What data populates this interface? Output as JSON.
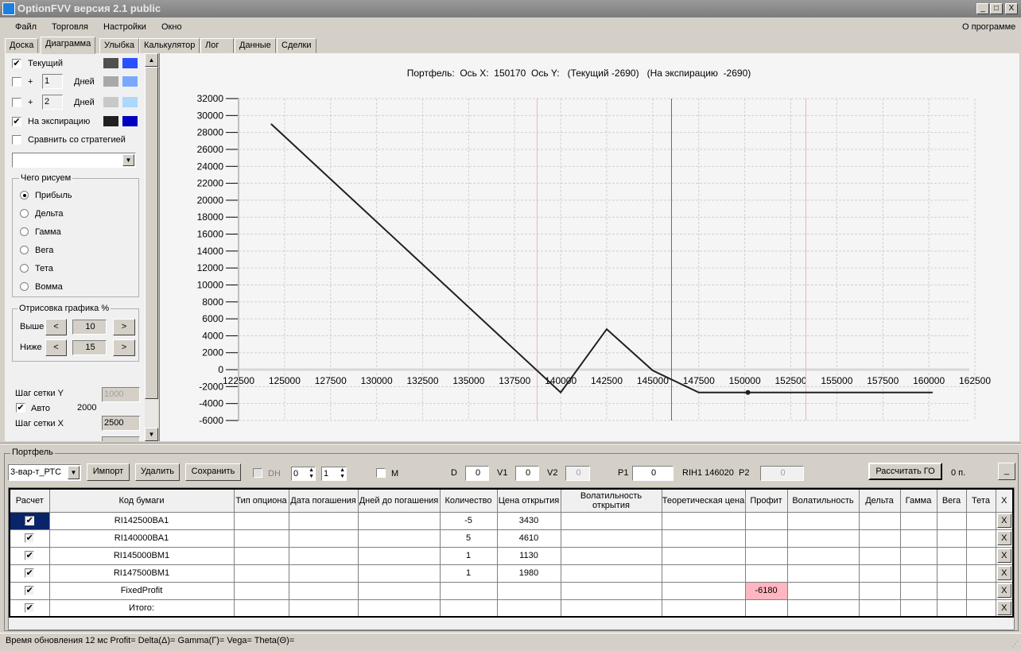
{
  "window": {
    "title": "OptionFVV версия 2.1 public",
    "minimize": "_",
    "maximize": "□",
    "close": "X"
  },
  "menu": {
    "items": [
      "Файл",
      "Торговля",
      "Настройки",
      "Окно"
    ],
    "about": "О программе"
  },
  "tabs": [
    "Доска",
    "Диаграмма",
    "Улыбка",
    "Калькулятор",
    "Лог",
    "Данные",
    "Сделки"
  ],
  "left": {
    "current": {
      "label": "Текущий",
      "checked": true,
      "color1": "#505050",
      "color2": "#2a50ff"
    },
    "plus1": {
      "plus": "+",
      "value": "1",
      "unit": "Дней",
      "checked": false,
      "color1": "#a8a8a8",
      "color2": "#7aa8ff"
    },
    "plus2": {
      "plus": "+",
      "value": "2",
      "unit": "Дней",
      "checked": false,
      "color1": "#c8c8c8",
      "color2": "#aad8ff"
    },
    "expiry": {
      "label": "На экспирацию",
      "checked": true,
      "color1": "#202020",
      "color2": "#0000c0"
    },
    "compare": {
      "label": "Сравнить со стратегией",
      "checked": false
    },
    "draw_group": "Чего рисуем",
    "draw_options": [
      "Прибыль",
      "Дельта",
      "Гамма",
      "Вега",
      "Тета",
      "Вомма"
    ],
    "draw_selected": 0,
    "range_group": "Отрисовка графика %",
    "above_label": "Выше",
    "above_value": "10",
    "below_label": "Ниже",
    "below_value": "15",
    "prev": "<",
    "next": ">",
    "grid_y_label": "Шаг сетки Y",
    "grid_y_value": "1000",
    "auto_label": "Авто",
    "auto_value": "2000",
    "grid_x_label": "Шаг сетки X",
    "grid_x_value": "2500"
  },
  "chart_data": {
    "type": "line",
    "title": "Портфель:  Ось X:  150170  Ось Y:   (Текущий -2690)   (На экспирацию  -2690)",
    "xlim": [
      122500,
      162500
    ],
    "ylim": [
      -6000,
      32000
    ],
    "xticks": [
      122500,
      125000,
      127500,
      130000,
      132500,
      135000,
      137500,
      140000,
      142500,
      145000,
      147500,
      150000,
      152500,
      155000,
      157500,
      160000,
      162500
    ],
    "yticks": [
      32000,
      30000,
      28000,
      26000,
      24000,
      22000,
      20000,
      18000,
      16000,
      14000,
      12000,
      10000,
      8000,
      6000,
      4000,
      2000,
      0,
      -2000,
      -4000,
      -6000
    ],
    "grid": true,
    "series": [
      {
        "name": "На экспирацию",
        "color": "#202020",
        "x": [
          124270,
          140000,
          142500,
          145000,
          147500,
          160200
        ],
        "y": [
          29000,
          -2690,
          4780,
          -100,
          -2690,
          -2690
        ]
      }
    ],
    "cursor": {
      "x": 150170,
      "y": -2690
    },
    "current_price": 146020,
    "range_lines": [
      138720,
      153320
    ]
  },
  "portfolio": {
    "group": "Портфель",
    "strategy": "3-вар-т_РТС",
    "import": "Импорт",
    "delete": "Удалить",
    "save": "Сохранить",
    "dh": "DH",
    "spin1": "0",
    "spin2": "1",
    "m": "M",
    "d_label": "D",
    "d": "0",
    "v1_label": "V1",
    "v1": "0",
    "v2_label": "V2",
    "v2": "0",
    "p1_label": "P1",
    "p1": "0",
    "ticker": "RIH1 146020",
    "p2_label": "P2",
    "p2": "0",
    "calc_go": "Рассчитать ГО",
    "go_value": "0 п.",
    "collapse": "_",
    "columns": [
      "Расчет",
      "Код бумаги",
      "Тип опциона",
      "Дата погашения",
      "Дней до погашения",
      "Количество",
      "Цена открытия",
      "Волатильность открытия",
      "Теоретическая цена",
      "Профит",
      "Волатильность",
      "Дельта",
      "Гамма",
      "Вега",
      "Тета",
      "X"
    ],
    "rows": [
      {
        "code": "RI142500BA1",
        "qty": "-5",
        "price": "3430",
        "profit": ""
      },
      {
        "code": "RI140000BA1",
        "qty": "5",
        "price": "4610",
        "profit": ""
      },
      {
        "code": "RI145000BM1",
        "qty": "1",
        "price": "1130",
        "profit": ""
      },
      {
        "code": "RI147500BM1",
        "qty": "1",
        "price": "1980",
        "profit": ""
      },
      {
        "code": "FixedProfit",
        "qty": "",
        "price": "",
        "profit": "-6180"
      },
      {
        "code": "Итого:",
        "qty": "",
        "price": "",
        "profit": ""
      }
    ],
    "delete_x": "X"
  },
  "status": "Время обновления 12 мс  Profit= Delta(Δ)= Gamma(Г)= Vega= Theta(Θ)="
}
